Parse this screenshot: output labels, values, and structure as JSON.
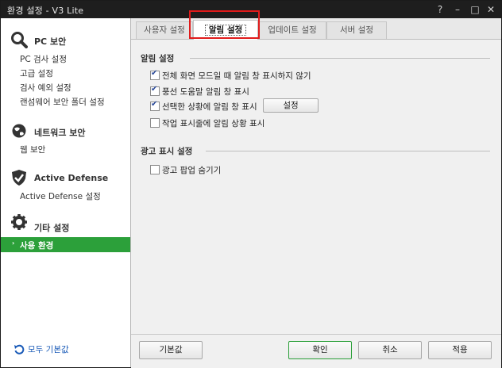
{
  "window": {
    "title": "환경 설정 - V3 Lite",
    "help_glyph": "?",
    "minimize_glyph": "–",
    "maximize_glyph": "□",
    "close_glyph": "✕"
  },
  "sidebar": {
    "sections": [
      {
        "title": "PC 보안",
        "icon": "search-icon",
        "items": [
          "PC 검사 설정",
          "고급 설정",
          "검사 예외 설정",
          "랜섬웨어 보안 폴더 설정"
        ]
      },
      {
        "title": "네트워크 보안",
        "icon": "globe-icon",
        "items": [
          "웹 보안"
        ]
      },
      {
        "title": "Active Defense",
        "icon": "shield-check-icon",
        "items": [
          "Active Defense 설정"
        ]
      },
      {
        "title": "기타 설정",
        "icon": "gear-icon",
        "items": [
          "사용 환경"
        ]
      }
    ],
    "selected_item": "사용 환경",
    "selected_arrow": "›",
    "reset_all_label": "모두 기본값",
    "accent_color": "#2ca03a"
  },
  "tabs": [
    {
      "label": "사용자 설정",
      "active": false
    },
    {
      "label": "알림 설정",
      "active": true
    },
    {
      "label": "업데이트 설정",
      "active": false
    },
    {
      "label": "서버 설정",
      "active": false
    }
  ],
  "content": {
    "notification_group": {
      "title": "알림 설정",
      "options": [
        {
          "label": "전체 화면 모드일 때 알림 창 표시하지 않기",
          "checked": true
        },
        {
          "label": "풍선 도움말 알림 창 표시",
          "checked": true
        },
        {
          "label": "선택한 상황에 알림 창 표시",
          "checked": true,
          "button": "설정"
        },
        {
          "label": "작업 표시줄에 알림 상황 표시",
          "checked": false
        }
      ]
    },
    "ad_group": {
      "title": "광고 표시 설정",
      "options": [
        {
          "label": "광고 팝업 숨기기",
          "checked": false
        }
      ]
    }
  },
  "footer": {
    "default_label": "기본값",
    "ok_label": "확인",
    "cancel_label": "취소",
    "apply_label": "적용"
  },
  "checkmark_glyph": "✔"
}
